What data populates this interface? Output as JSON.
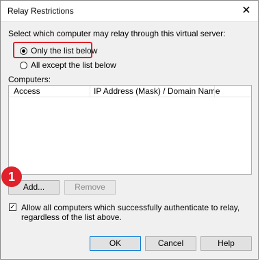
{
  "window": {
    "title": "Relay Restrictions"
  },
  "prompt": "Select which computer may relay through this virtual server:",
  "options": {
    "only_list": "Only the list below",
    "all_except": "All except the list below"
  },
  "computers_label": "Computers:",
  "list": {
    "columns": [
      "Access",
      "IP Address (Mask) / Domain Name"
    ],
    "rows": []
  },
  "buttons": {
    "add": "Add...",
    "remove": "Remove",
    "ok": "OK",
    "cancel": "Cancel",
    "help": "Help"
  },
  "callout": "1",
  "checkbox": {
    "checked": true,
    "label": "Allow all computers which successfully authenticate to relay, regardless of the list above."
  },
  "colors": {
    "highlight": "#e0202a",
    "badge": "#e0202a"
  }
}
